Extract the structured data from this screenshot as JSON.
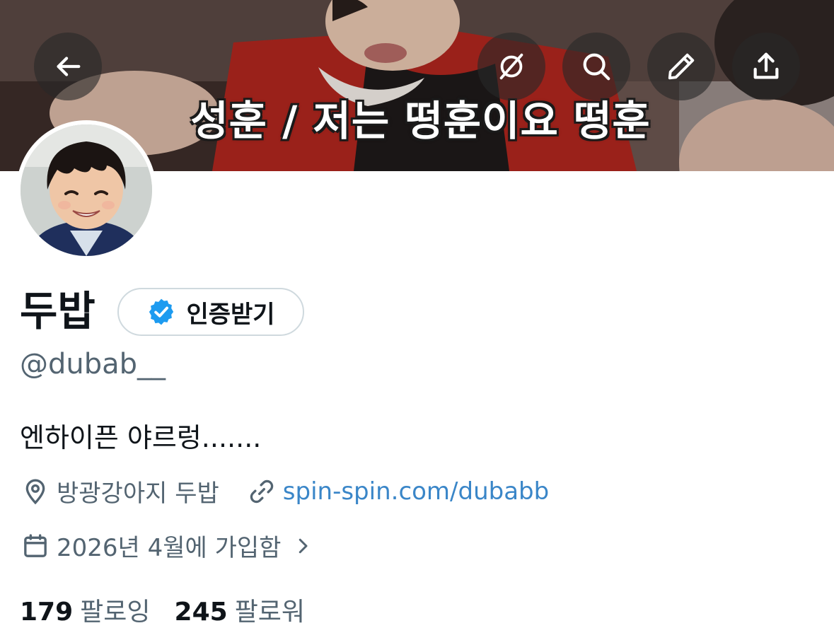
{
  "banner": {
    "caption": "성훈 / 저는 떵훈이요 떵훈"
  },
  "toolbar": {
    "back_icon": "arrow-left-icon",
    "grok_icon": "grok-icon",
    "search_icon": "search-icon",
    "edit_icon": "pencil-icon",
    "share_icon": "share-upload-icon"
  },
  "profile": {
    "display_name": "두밥",
    "verify_label": "인증받기",
    "handle": "@dubab__",
    "bio": "엔하이픈 야르렁.......",
    "location": "방광강아지 두밥",
    "website": "spin-spin.com/dubabb",
    "joined": "2026년 4월에 가입함",
    "following_count": "179",
    "following_label": "팔로잉",
    "followers_count": "245",
    "followers_label": "팔로워"
  },
  "colors": {
    "verify_badge": "#1d9bf0",
    "link": "#3a86c8",
    "secondary_text": "#536471",
    "primary_text": "#0f1419"
  }
}
